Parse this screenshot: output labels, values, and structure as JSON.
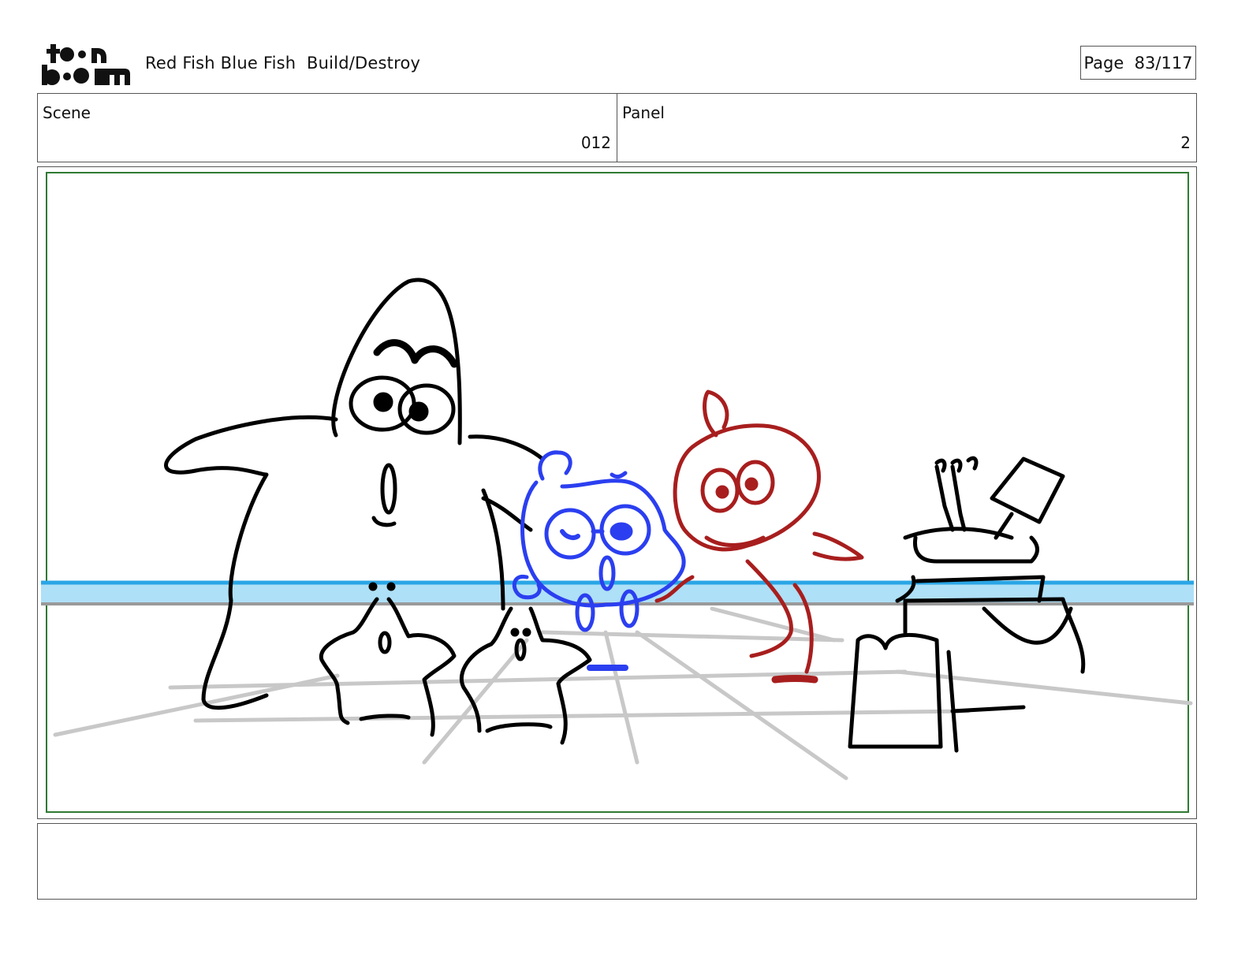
{
  "header": {
    "logo_text": "toon boom",
    "project_title": "Red Fish Blue Fish  Build/Destroy",
    "page_label": "Page",
    "page_value": "83/117"
  },
  "info": {
    "scene_label": "Scene",
    "scene_value": "012",
    "panel_label": "Panel",
    "panel_value": "2"
  },
  "panel": {
    "description": "",
    "colors": {
      "safe_frame": "#2f7a33",
      "water": "#aee0f7",
      "water_line": "#2aa6e6",
      "floor_line": "#c8c8c8",
      "ink": "#000000",
      "blue_fish": "#2b3ff0",
      "red_fish": "#a81e1e"
    }
  },
  "notes": {
    "text": ""
  }
}
